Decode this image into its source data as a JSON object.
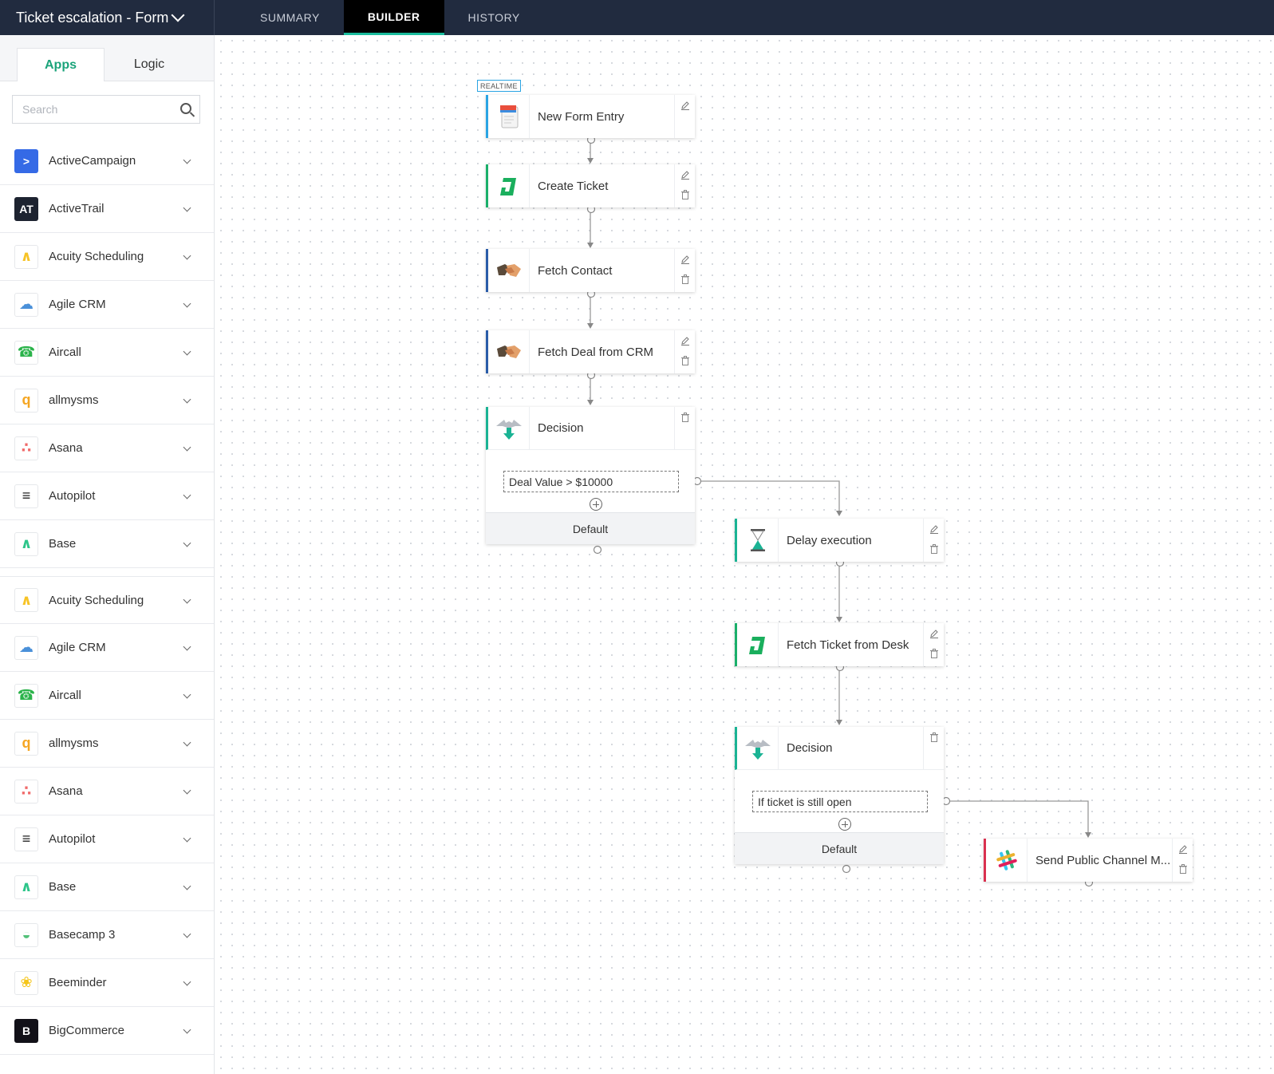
{
  "header": {
    "workflow_title": "Ticket escalation - Form",
    "tabs": [
      "SUMMARY",
      "BUILDER",
      "HISTORY"
    ],
    "active_tab": "BUILDER",
    "accent_color": "#1abc9c",
    "bg_color": "#212b3f"
  },
  "sidebar": {
    "tabs": [
      "Apps",
      "Logic"
    ],
    "active_tab": "Apps",
    "search_placeholder": "Search",
    "apps": [
      {
        "name": "ActiveCampaign",
        "icon": "activecampaign-icon",
        "color": "#356ae6"
      },
      {
        "name": "ActiveTrail",
        "icon": "activetrail-icon",
        "color": "#1d2330"
      },
      {
        "name": "Acuity Scheduling",
        "icon": "acuity-icon",
        "color": "#f7c325"
      },
      {
        "name": "Agile CRM",
        "icon": "agilecrm-cloud-icon",
        "color": "#4a90d9"
      },
      {
        "name": "Aircall",
        "icon": "aircall-phone-icon",
        "color": "#2bb34b"
      },
      {
        "name": "allmysms",
        "icon": "allmysms-icon",
        "color": "#f5a623"
      },
      {
        "name": "Asana",
        "icon": "asana-icon",
        "color": "#f06a6a"
      },
      {
        "name": "Autopilot",
        "icon": "autopilot-icon",
        "color": "#222222"
      },
      {
        "name": "Base",
        "icon": "base-icon",
        "color": "#2dc58a"
      },
      {
        "name": "Acuity Scheduling",
        "icon": "acuity-icon",
        "color": "#f7c325"
      },
      {
        "name": "Agile CRM",
        "icon": "agilecrm-cloud-icon",
        "color": "#4a90d9"
      },
      {
        "name": "Aircall",
        "icon": "aircall-phone-icon",
        "color": "#2bb34b"
      },
      {
        "name": "allmysms",
        "icon": "allmysms-icon",
        "color": "#f5a623"
      },
      {
        "name": "Asana",
        "icon": "asana-icon",
        "color": "#f06a6a"
      },
      {
        "name": "Autopilot",
        "icon": "autopilot-icon",
        "color": "#222222"
      },
      {
        "name": "Base",
        "icon": "base-icon",
        "color": "#2dc58a"
      },
      {
        "name": "Basecamp 3",
        "icon": "basecamp-icon",
        "color": "#53c179"
      },
      {
        "name": "Beeminder",
        "icon": "beeminder-icon",
        "color": "#f5c518"
      },
      {
        "name": "BigCommerce",
        "icon": "bigcommerce-icon",
        "color": "#121118"
      }
    ]
  },
  "flow": {
    "trigger_badge": "REALTIME",
    "nodes": [
      {
        "label": "New Form Entry",
        "icon": "form-icon"
      },
      {
        "label": "Create Ticket",
        "icon": "zoho-desk-icon"
      },
      {
        "label": "Fetch Contact",
        "icon": "handshake-icon"
      },
      {
        "label": "Fetch Deal from CRM",
        "icon": "handshake-icon"
      },
      {
        "label": "Delay execution",
        "icon": "hourglass-icon"
      },
      {
        "label": "Fetch Ticket from Desk",
        "icon": "zoho-desk-icon"
      },
      {
        "label": "Send Public Channel M...",
        "icon": "slack-icon"
      }
    ],
    "decisions": [
      {
        "label": "Decision",
        "condition": "Deal Value > $10000",
        "default_label": "Default"
      },
      {
        "label": "Decision",
        "condition": "If ticket is still open",
        "default_label": "Default"
      }
    ]
  }
}
